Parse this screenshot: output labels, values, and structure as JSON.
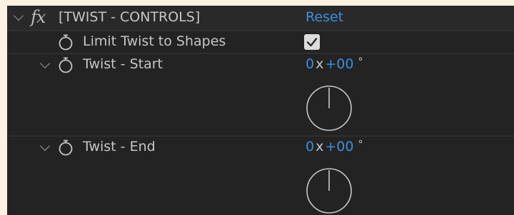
{
  "effect": {
    "fx_glyph": "fx",
    "name": "[TWIST - CONTROLS]",
    "reset_label": "Reset"
  },
  "properties": [
    {
      "label": "Limit Twist to Shapes",
      "control": "checkbox",
      "checked": true
    },
    {
      "label": "Twist - Start",
      "control": "angle",
      "revolutions": "0",
      "times": "x",
      "degrees": "+00",
      "degree_symbol": "°"
    },
    {
      "label": "Twist - End",
      "control": "angle",
      "revolutions": "0",
      "times": "x",
      "degrees": "+00",
      "degree_symbol": "°"
    }
  ],
  "colors": {
    "panel_background": "#232323",
    "value_blue": "#3d8edb",
    "label_text": "#c6c6c6",
    "page_background": "#fdf1e2"
  },
  "icons": [
    "chevron-down-icon",
    "stopwatch-icon",
    "checkmark-icon",
    "angle-dial"
  ]
}
